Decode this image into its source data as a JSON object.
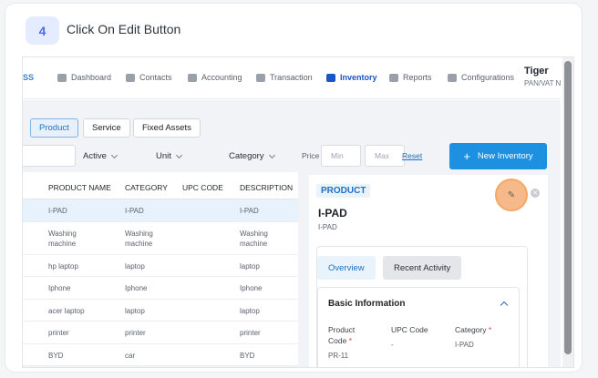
{
  "step": {
    "number": "4",
    "title": "Click On Edit Button"
  },
  "nav": {
    "logo": "SS",
    "items": [
      {
        "label": "Dashboard",
        "icon": "dashboard-icon"
      },
      {
        "label": "Contacts",
        "icon": "contacts-icon"
      },
      {
        "label": "Accounting",
        "icon": "accounting-icon"
      },
      {
        "label": "Transaction",
        "icon": "transaction-icon"
      },
      {
        "label": "Inventory",
        "icon": "inventory-icon",
        "active": true
      },
      {
        "label": "Reports",
        "icon": "reports-icon"
      },
      {
        "label": "Configurations",
        "icon": "gear-icon"
      }
    ],
    "user_name": "Tiger",
    "user_sub": "PAN/VAT N"
  },
  "tabs": [
    "Product",
    "Service",
    "Fixed Assets"
  ],
  "filters": {
    "active": "Active",
    "unit": "Unit",
    "category": "Category",
    "price": "Price",
    "min_placeholder": "Min",
    "max_placeholder": "Max",
    "reset": "Reset",
    "new_button": "New Inventory"
  },
  "table": {
    "headers": [
      "PRODUCT NAME",
      "CATEGORY",
      "UPC CODE",
      "DESCRIPTION"
    ],
    "rows": [
      [
        "I-PAD",
        "I-PAD",
        "",
        "I-PAD"
      ],
      [
        "Washing machine",
        "Washing machine",
        "",
        "Washing machine"
      ],
      [
        "hp laptop",
        "laptop",
        "",
        "laptop"
      ],
      [
        "Iphone",
        "Iphone",
        "",
        "Iphone"
      ],
      [
        "acer laptop",
        "laptop",
        "",
        "laptop"
      ],
      [
        "printer",
        "printer",
        "",
        "printer"
      ],
      [
        "BYD",
        "car",
        "",
        "BYD"
      ]
    ]
  },
  "detail": {
    "tag": "PRODUCT",
    "name": "I-PAD",
    "sub": "I-PAD",
    "tab_overview": "Overview",
    "tab_activity": "Recent Activity",
    "section": "Basic Information",
    "f1_label_a": "Product",
    "f1_label_b": "Code",
    "f1_value": "PR-11",
    "f2_label": "UPC Code",
    "f2_value": "-",
    "f3_label": "Category",
    "f3_value": "I-PAD"
  },
  "colors": {
    "accent": "#1e90e0",
    "highlight": "#f6b98a",
    "badge": "#4a6cf0"
  }
}
